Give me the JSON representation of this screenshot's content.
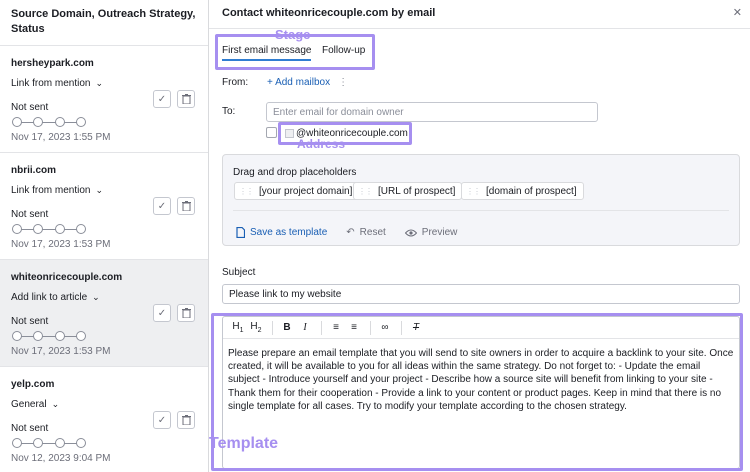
{
  "left_panel": {
    "header": "Source Domain, Outreach Strategy, Status",
    "items": [
      {
        "domain": "hersheypark.com",
        "strategy": "Link from mention",
        "status": "Not sent",
        "date": "Nov 17, 2023 1:55 PM"
      },
      {
        "domain": "nbrii.com",
        "strategy": "Link from mention",
        "status": "Not sent",
        "date": "Nov 17, 2023 1:53 PM"
      },
      {
        "domain": "whiteonricecouple.com",
        "strategy": "Add link to article",
        "status": "Not sent",
        "date": "Nov 17, 2023 1:53 PM"
      },
      {
        "domain": "yelp.com",
        "strategy": "General",
        "status": "Not sent",
        "date": "Nov 12, 2023 9:04 PM"
      }
    ]
  },
  "right_panel": {
    "title": "Contact whiteonricecouple.com by email",
    "close_icon": "close-icon",
    "tabs": [
      {
        "label": "First email message",
        "active": true
      },
      {
        "label": "Follow-up",
        "active": false
      }
    ],
    "from_label": "From:",
    "add_mailbox": "+ Add mailbox",
    "to_label": "To:",
    "to_placeholder": "Enter email for domain owner",
    "address_suggestion": "@whiteonricecouple.com",
    "placeholders": {
      "title": "Drag and drop placeholders",
      "chips": [
        "[your project domain]",
        "[URL of prospect]",
        "[domain of prospect]"
      ],
      "save_template": "Save as template",
      "reset": "Reset",
      "preview": "Preview"
    },
    "subject_label": "Subject",
    "subject_value": "Please link to my website",
    "editor": {
      "toolbar": [
        "H1",
        "H2",
        "B",
        "I",
        "ordered-list",
        "bullet-list",
        "link",
        "clear-format"
      ],
      "body": "Please prepare an email template that you will send to site owners in order to acquire a backlink to your site. Once created, it will be available to you for all ideas within the same strategy. Do not forget to: - Update the email subject - Introduce yourself and your project - Describe how a source site will benefit from linking to your site - Thank them for their cooperation - Provide a link to your content or product pages. Keep in mind that there is no single template for all cases. Try to modify your template according to the chosen strategy."
    }
  },
  "annotations": {
    "stage": "Stage",
    "address": "Address",
    "template": "Template",
    "color": "#a68ff0"
  },
  "colors": {
    "accent_link": "#1a5fb4",
    "tab_underline": "#2f7dd1",
    "selected_row": "#eeeff1"
  }
}
